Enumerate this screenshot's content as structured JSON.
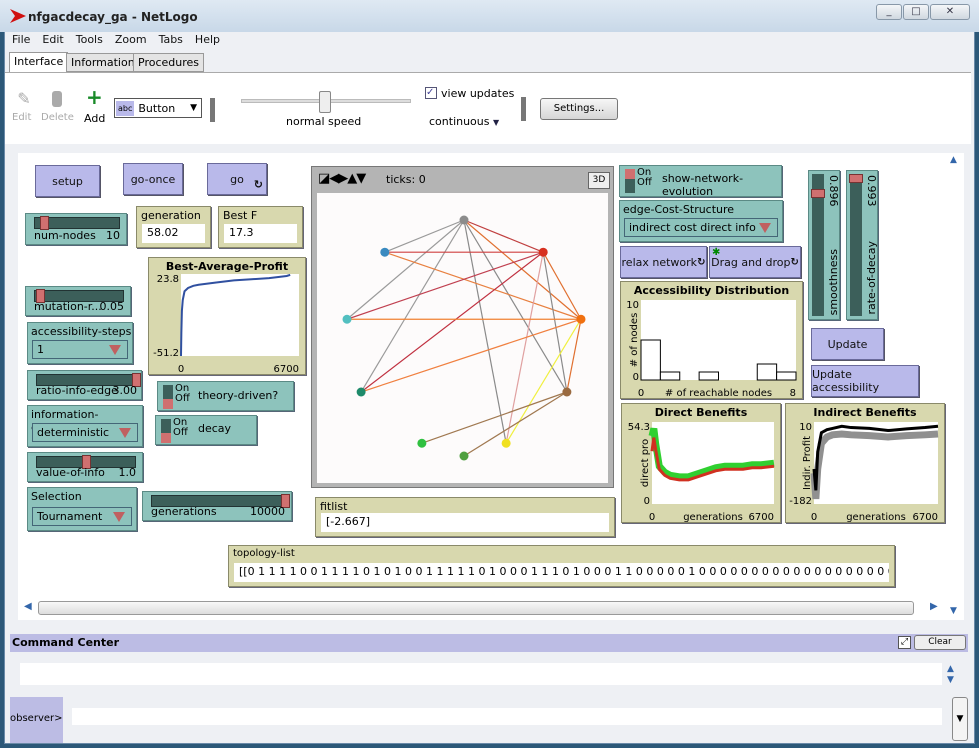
{
  "window": {
    "title": "nfgacdecay_ga - NetLogo",
    "controls": [
      "_",
      "□",
      "✕"
    ]
  },
  "menu": [
    "File",
    "Edit",
    "Tools",
    "Zoom",
    "Tabs",
    "Help"
  ],
  "tabs": [
    {
      "label": "Interface",
      "active": true
    },
    {
      "label": "Information"
    },
    {
      "label": "Procedures"
    }
  ],
  "toolbar": {
    "edit": "Edit",
    "delete": "Delete",
    "add": "Add",
    "widget_type": "Button",
    "widget_abc": "abc",
    "speed_label": "normal speed",
    "speed_value": 0.5,
    "view_updates_label": "view updates",
    "view_updates_checked": true,
    "update_mode": "continuous",
    "settings": "Settings..."
  },
  "widgets": {
    "setup": "setup",
    "go_once": "go-once",
    "go": "go",
    "num_nodes": {
      "label": "num-nodes",
      "value": "10",
      "fraction": 0.1
    },
    "generation": {
      "label": "generation",
      "value": "58.02"
    },
    "best_f": {
      "label": "Best F",
      "value": "17.3"
    },
    "mutation": {
      "label": "mutation-r...",
      "value": "0.05",
      "fraction": 0.05
    },
    "accessibility_steps": {
      "label": "accessibility-steps",
      "value": "1"
    },
    "ratio_info_edge": {
      "label": "ratio-info-edge",
      "value": "3.00",
      "fraction": 1.0
    },
    "theory_driven": {
      "label": "theory-driven?",
      "on": "On",
      "off": "Off",
      "state": "off"
    },
    "information_endowment": {
      "label": "information-endowm...",
      "value": "deterministic"
    },
    "decay": {
      "label": "decay",
      "on": "On",
      "off": "Off",
      "state": "off"
    },
    "value_of_info": {
      "label": "value-of-info",
      "value": "1.0",
      "fraction": 0.5
    },
    "selection": {
      "label": "Selection",
      "value": "Tournament"
    },
    "generations": {
      "label": "generations",
      "value": "10000",
      "fraction": 1.0
    },
    "show_network_evolution": {
      "label": "show-network-evolution",
      "on": "On",
      "off": "Off",
      "state": "on"
    },
    "edge_cost_structure": {
      "label": "edge-Cost-Structure",
      "value": "indirect cost direct info"
    },
    "relax_network": "relax network",
    "drag_and_drop": "Drag and drop",
    "smoothness": {
      "label": "smoothness",
      "value": "0.896",
      "fraction": 0.896
    },
    "rate_of_decay": {
      "label": "rate-of-decay",
      "value": "0.993",
      "fraction": 0.993
    },
    "update": "Update",
    "update_accessibility": "Update accessibility",
    "fitlist": {
      "label": "fitlist",
      "value": "[-2.667]"
    },
    "topology_list": {
      "label": "topology-list",
      "value": "[[0 1 1 1 1 0 0 1 1 1 1 0 1 0 1 0 0 1 1 1 1 1 0 1 0 0 0 1 1 1 0 1 0 0 0 1 1 0 0 0 0 0 1 0 0 0 0 0 0 0 0 0 0 0 0 0 0 0 0 0 0 0 0 0 0 0 0 0"
    }
  },
  "view": {
    "ticks_label": "ticks: 0",
    "btn_3d": "3D",
    "nodes": [
      {
        "id": "gray",
        "color": "#8c8c8c"
      },
      {
        "id": "red",
        "color": "#d7301f"
      },
      {
        "id": "blue",
        "color": "#3a8ac0"
      },
      {
        "id": "cyan",
        "color": "#52bfc0"
      },
      {
        "id": "orange",
        "color": "#f07010"
      },
      {
        "id": "teal",
        "color": "#1e8a6a"
      },
      {
        "id": "brown",
        "color": "#9a6a40"
      },
      {
        "id": "green",
        "color": "#30c040"
      },
      {
        "id": "yellow",
        "color": "#f0e020"
      },
      {
        "id": "darkgreen",
        "color": "#50a040"
      }
    ],
    "links": [
      [
        "gray",
        "blue",
        "#9a9a9a"
      ],
      [
        "gray",
        "red",
        "#c04040"
      ],
      [
        "gray",
        "orange",
        "#e07030"
      ],
      [
        "gray",
        "cyan",
        "#9a9a9a"
      ],
      [
        "gray",
        "teal",
        "#9a9a9a"
      ],
      [
        "gray",
        "yellow",
        "#8a8a8a"
      ],
      [
        "gray",
        "brown",
        "#8a8a8a"
      ],
      [
        "blue",
        "red",
        "#d04040"
      ],
      [
        "blue",
        "orange",
        "#e88040"
      ],
      [
        "red",
        "cyan",
        "#c04050"
      ],
      [
        "red",
        "teal",
        "#c03040"
      ],
      [
        "red",
        "yellow",
        "#e0a0a0"
      ],
      [
        "red",
        "orange",
        "#e07030"
      ],
      [
        "red",
        "brown",
        "#8a8a8a"
      ],
      [
        "cyan",
        "orange",
        "#f08030"
      ],
      [
        "teal",
        "orange",
        "#f08040"
      ],
      [
        "orange",
        "brown",
        "#e07030"
      ],
      [
        "orange",
        "yellow",
        "#f0f040"
      ],
      [
        "brown",
        "green",
        "#a07850"
      ],
      [
        "brown",
        "darkgreen",
        "#a07850"
      ]
    ]
  },
  "chart_data": [
    {
      "title": "Best-Average-Profit",
      "type": "line",
      "xlim": [
        0,
        6700
      ],
      "ylim": [
        -51.2,
        23.8
      ],
      "x_ticks": [
        "0",
        "6700"
      ],
      "y_ticks": [
        "23.8",
        "-51.2"
      ],
      "series": [
        {
          "color": "#3050a0",
          "x": [
            0,
            20,
            50,
            100,
            200,
            400,
            700,
            1000,
            1500,
            2000,
            3000,
            4000,
            5000,
            6000,
            6200
          ],
          "y": [
            -51.2,
            -30,
            -10,
            0,
            8,
            11,
            13,
            14,
            15,
            16,
            18,
            19,
            20,
            22,
            23
          ]
        }
      ]
    },
    {
      "title": "Accessibility Distribution",
      "type": "bar",
      "xlabel": "# of reachable nodes",
      "ylabel": "# of nodes",
      "xlim": [
        0,
        8
      ],
      "ylim": [
        0,
        10
      ],
      "x_ticks": [
        "0",
        "8"
      ],
      "y_ticks": [
        "10",
        "0"
      ],
      "categories": [
        0,
        1,
        2,
        3,
        4,
        5,
        6,
        7
      ],
      "values": [
        5,
        1,
        0,
        1,
        0,
        0,
        2,
        1
      ]
    },
    {
      "title": "Direct Benefits",
      "type": "line",
      "xlabel": "generations",
      "ylabel": "direct pro",
      "xlim": [
        0,
        6700
      ],
      "ylim": [
        0,
        54.3
      ],
      "x_ticks": [
        "0",
        "6700"
      ],
      "y_ticks": [
        "54.3",
        "0"
      ],
      "series": [
        {
          "color": "#30d030",
          "x": [
            0,
            100,
            200,
            400,
            700,
            1000,
            1500,
            2000,
            2500,
            3000,
            3500,
            4000,
            4500,
            5000,
            5500,
            6000,
            6700
          ],
          "y": [
            45,
            50,
            40,
            25,
            21,
            19,
            18,
            18,
            20,
            22,
            24,
            25,
            25,
            25,
            26,
            26,
            27
          ]
        },
        {
          "color": "#d03020",
          "x": [
            0,
            100,
            200,
            400,
            700,
            1000,
            1500,
            2000,
            2500,
            3000,
            3500,
            4000,
            4500,
            5000,
            5500,
            6000,
            6700
          ],
          "y": [
            35,
            44,
            36,
            23,
            19,
            17,
            16,
            16,
            18,
            20,
            22,
            23,
            23,
            23,
            24,
            24,
            25
          ]
        }
      ]
    },
    {
      "title": "Indirect Benefits",
      "type": "line",
      "xlabel": "generations",
      "ylabel": "Indir. Profit",
      "xlim": [
        0,
        6700
      ],
      "ylim": [
        -182,
        10
      ],
      "x_ticks": [
        "0",
        "6700"
      ],
      "y_ticks": [
        "10",
        "-182"
      ],
      "series": [
        {
          "color": "#909090",
          "x": [
            0,
            100,
            200,
            400,
            700,
            1000,
            1500,
            2000,
            3000,
            4000,
            5000,
            6000,
            6700
          ],
          "y": [
            -110,
            -170,
            -100,
            -40,
            -25,
            -20,
            -18,
            -20,
            -22,
            -25,
            -22,
            -20,
            -18
          ]
        },
        {
          "color": "#000000",
          "x": [
            0,
            100,
            200,
            400,
            700,
            1000,
            1500,
            2000,
            3000,
            4000,
            5000,
            6000,
            6700
          ],
          "y": [
            -100,
            -150,
            -60,
            -15,
            -8,
            -5,
            0,
            -3,
            -5,
            -10,
            -6,
            -3,
            0
          ]
        }
      ]
    }
  ],
  "command_center": {
    "title": "Command Center",
    "clear": "Clear",
    "prompt": "observer>",
    "input": ""
  }
}
